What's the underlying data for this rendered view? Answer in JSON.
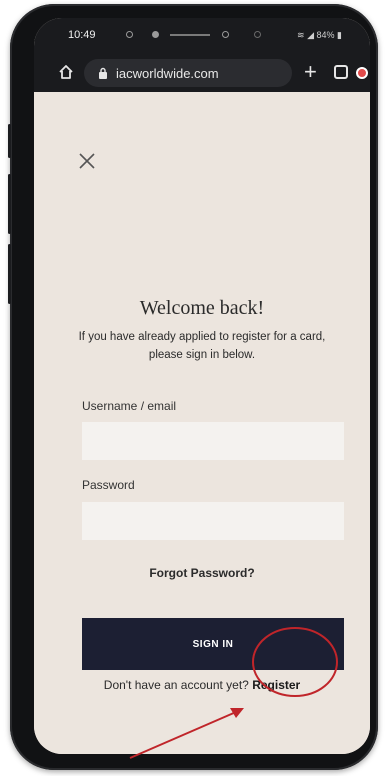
{
  "status_bar": {
    "time": "10:49",
    "battery": "84%"
  },
  "browser": {
    "url": "iacworldwide.com"
  },
  "login": {
    "title": "Welcome back!",
    "subtitle": "If you have already applied to register for a card, please sign in below.",
    "username_label": "Username / email",
    "username_value": "",
    "password_label": "Password",
    "password_value": "",
    "forgot_label": "Forgot Password?",
    "signin_label": "SIGN IN",
    "no_account_text": "Don't have an account yet?",
    "register_label": "Register"
  },
  "annotation": {
    "highlight_color": "#c0252a"
  }
}
